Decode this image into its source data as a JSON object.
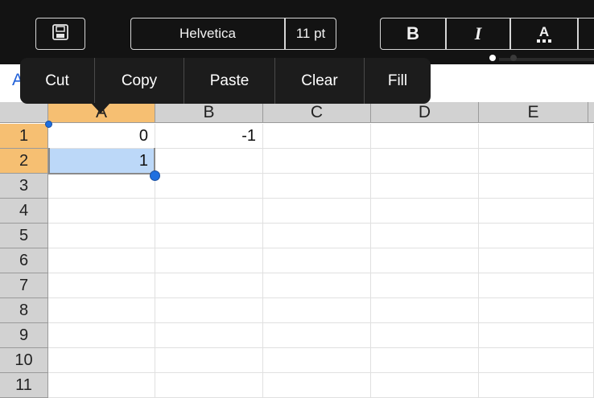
{
  "toolbar": {
    "save_icon": "floppy-disk-icon",
    "font_name": "Helvetica",
    "font_size": "11 pt",
    "bold_label": "B",
    "italic_label": "I",
    "font_color_label": "A",
    "font_color_icon": "font-color-icon"
  },
  "formula_bar": {
    "ref_text": "A"
  },
  "context_menu": {
    "items": [
      "Cut",
      "Copy",
      "Paste",
      "Clear",
      "Fill"
    ]
  },
  "grid": {
    "columns": [
      "A",
      "B",
      "C",
      "D",
      "E"
    ],
    "rows": [
      "1",
      "2",
      "3",
      "4",
      "5",
      "6",
      "7",
      "8",
      "9",
      "10",
      "11"
    ],
    "cells": {
      "A1": "0",
      "B1": "-1",
      "A2": "1"
    },
    "selected_column": "A",
    "selected_rows": [
      "1",
      "2"
    ]
  },
  "colors": {
    "toolbar_bg": "#131313",
    "menu_bg": "#1c1c1c",
    "header_highlight": "#f6bf72",
    "selection_fill": "#bcd8f8",
    "handle": "#1e6fe0"
  }
}
